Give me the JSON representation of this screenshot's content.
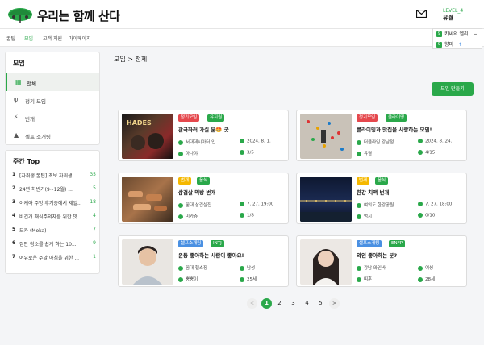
{
  "header": {
    "brand": "우리는 함께 산다",
    "level": "LEVEL_4",
    "user": "유월",
    "dropdown": [
      {
        "badge": "9",
        "label": "키씨의 엘리",
        "arrow": "−"
      },
      {
        "badge": "9",
        "label": "향미",
        "arrow": "↑"
      }
    ]
  },
  "nav": {
    "items": [
      "꿀팁",
      "모임",
      "고객 지원",
      "마이페이지"
    ]
  },
  "sidebar": {
    "title": "모임",
    "menu": [
      {
        "icon": "grid-icon",
        "label": "전체"
      },
      {
        "icon": "fork-knife-icon",
        "label": "정기 모임"
      },
      {
        "icon": "lightning-icon",
        "label": "번개"
      },
      {
        "icon": "tent-icon",
        "label": "셀프 소개팅"
      }
    ]
  },
  "weekly_top": {
    "title": "주간 Top",
    "items": [
      {
        "rank": "1",
        "title": "[자취생 꿀팁] 초보 자취생...",
        "count": "35"
      },
      {
        "rank": "2",
        "title": "24년 하반기(9~12월) ...",
        "count": "5"
      },
      {
        "rank": "3",
        "title": "이케아 주방 후기중에서 제일...",
        "count": "18"
      },
      {
        "rank": "4",
        "title": "비건개 채식주의자를 위한 맛...",
        "count": "4"
      },
      {
        "rank": "5",
        "title": "모카 (Moka)",
        "count": "7"
      },
      {
        "rank": "6",
        "title": "집안 청소를 쉽게 하는 10...",
        "count": "9"
      },
      {
        "rank": "7",
        "title": "여유로운 주말 아침을 위한 ...",
        "count": "1"
      }
    ]
  },
  "main": {
    "breadcrumb": "모임 > 전체",
    "create_button": "모임 만들기",
    "cards": [
      {
        "tags": [
          {
            "label": "정기모임",
            "color": "#e5484d"
          },
          {
            "label": "유지원",
            "color": "#2aa84a"
          }
        ],
        "title": "관극하러 가실 분🤩 굿",
        "loc": "서대데시아터 입...",
        "date": "2024. 8. 1.",
        "host": "아나야",
        "count": "3/5"
      },
      {
        "tags": [
          {
            "label": "정기모임",
            "color": "#e5484d"
          },
          {
            "label": "클라이밍",
            "color": "#2aa84a"
          }
        ],
        "title": "클라이밍과 맛집을 사랑하는 모임!",
        "loc": "더클라임 강남점",
        "date": "2024. 8. 24.",
        "host": "유월",
        "count": "4/15"
      },
      {
        "tags": [
          {
            "label": "번개",
            "color": "#f5b800"
          },
          {
            "label": "음식",
            "color": "#2aa84a"
          }
        ],
        "title": "삼겹살 먹방 번개",
        "loc": "꿈대 삼겹살집",
        "date": "7. 27. 19:00",
        "host": "미카츄",
        "count": "1/8"
      },
      {
        "tags": [
          {
            "label": "번개",
            "color": "#f5b800"
          },
          {
            "label": "음식",
            "color": "#2aa84a"
          }
        ],
        "title": "한강 치맥 번개",
        "loc": "여의도 한강공원",
        "date": "7. 27. 18:00",
        "host": "먹시",
        "count": "0/10"
      },
      {
        "tags": [
          {
            "label": "셀프소개팅",
            "color": "#4a90e2"
          },
          {
            "label": "INTJ",
            "color": "#2aa84a"
          }
        ],
        "title": "운동 좋아하는 사람이 좋아요!",
        "loc": "꿈대 헬스장",
        "date": "남성",
        "host": "뿡뿡이",
        "count": "25세"
      },
      {
        "tags": [
          {
            "label": "셀프소개팅",
            "color": "#4a90e2"
          },
          {
            "label": "ENFP",
            "color": "#2aa84a"
          }
        ],
        "title": "와인 좋아하는 분?",
        "loc": "강남 와인바",
        "date": "여성",
        "host": "띠훈",
        "count": "28세"
      }
    ]
  },
  "pagination": {
    "prev": "<",
    "pages": [
      "1",
      "2",
      "3",
      "4",
      "5"
    ],
    "next": ">"
  }
}
